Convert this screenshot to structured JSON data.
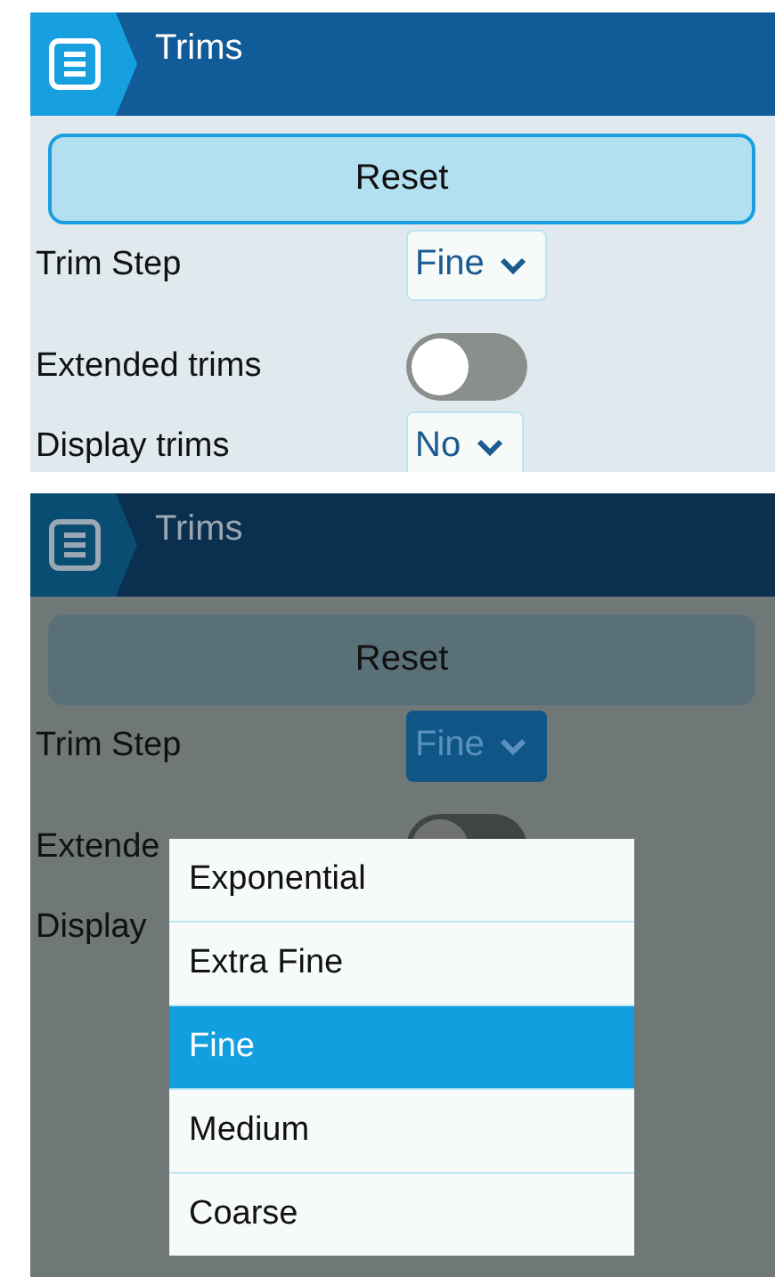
{
  "screens": [
    {
      "dimmed": false,
      "header": {
        "title": "Trims"
      },
      "reset_button": "Reset",
      "settings": [
        {
          "kind": "select",
          "label": "Trim Step",
          "value": "Fine",
          "open": false
        },
        {
          "kind": "toggle",
          "label": "Extended trims",
          "on": false
        },
        {
          "kind": "select",
          "label": "Display trims",
          "value": "No",
          "open": false
        }
      ]
    },
    {
      "dimmed": true,
      "header": {
        "title": "Trims"
      },
      "reset_button": "Reset",
      "settings": [
        {
          "kind": "select",
          "label": "Trim Step",
          "value": "Fine",
          "open": true
        },
        {
          "kind": "toggle",
          "label": "Extende",
          "on": false
        },
        {
          "kind": "select",
          "label": "Display"
        }
      ],
      "menu": {
        "items": [
          {
            "label": "Exponential",
            "selected": false
          },
          {
            "label": "Extra Fine",
            "selected": false
          },
          {
            "label": "Fine",
            "selected": true
          },
          {
            "label": "Medium",
            "selected": false
          },
          {
            "label": "Coarse",
            "selected": false
          }
        ]
      }
    }
  ]
}
